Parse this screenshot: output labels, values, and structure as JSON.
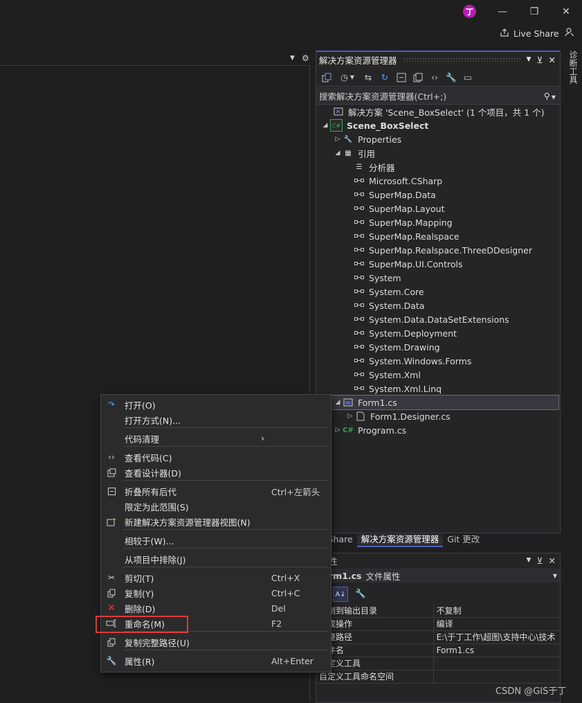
{
  "titlebar": {
    "avatar": "丁",
    "live_share": "Live Share"
  },
  "side_tab": "诊断工具",
  "solution_explorer": {
    "title": "解决方案资源管理器",
    "search_placeholder": "搜索解决方案资源管理器(Ctrl+;)",
    "tree": [
      {
        "label": "解决方案 'Scene_BoxSelect' (1 个项目，共 1 个)",
        "icon": "solution-icon"
      },
      {
        "label": "Scene_BoxSelect",
        "icon": "csharp-project-icon"
      },
      {
        "label": "Properties",
        "icon": "wrench-icon"
      },
      {
        "label": "引用",
        "icon": "references-icon"
      },
      {
        "label": "分析器",
        "icon": "analyzer-icon"
      },
      {
        "label": "Microsoft.CSharp",
        "icon": "reference-icon"
      },
      {
        "label": "SuperMap.Data",
        "icon": "reference-icon"
      },
      {
        "label": "SuperMap.Layout",
        "icon": "reference-icon"
      },
      {
        "label": "SuperMap.Mapping",
        "icon": "reference-icon"
      },
      {
        "label": "SuperMap.Realspace",
        "icon": "reference-icon"
      },
      {
        "label": "SuperMap.Realspace.ThreeDDesigner",
        "icon": "reference-icon"
      },
      {
        "label": "SuperMap.UI.Controls",
        "icon": "reference-icon"
      },
      {
        "label": "System",
        "icon": "reference-icon"
      },
      {
        "label": "System.Core",
        "icon": "reference-icon"
      },
      {
        "label": "System.Data",
        "icon": "reference-icon"
      },
      {
        "label": "System.Data.DataSetExtensions",
        "icon": "reference-icon"
      },
      {
        "label": "System.Deployment",
        "icon": "reference-icon"
      },
      {
        "label": "System.Drawing",
        "icon": "reference-icon"
      },
      {
        "label": "System.Windows.Forms",
        "icon": "reference-icon"
      },
      {
        "label": "System.Xml",
        "icon": "reference-icon"
      },
      {
        "label": "System.Xml.Linq",
        "icon": "reference-icon"
      },
      {
        "label": "Form1.cs",
        "icon": "form-icon"
      },
      {
        "label": "Form1.Designer.cs",
        "icon": "file-icon"
      },
      {
        "label": "Program.cs",
        "icon": "csharp-file-icon"
      }
    ]
  },
  "tabs": [
    "e Share",
    "解决方案资源管理器",
    "Git 更改"
  ],
  "properties": {
    "title": "性",
    "object": "rm1.cs",
    "object_type": "文件属性",
    "rows": [
      {
        "name": "复制到输出目录",
        "value": "不复制"
      },
      {
        "name": "生成操作",
        "value": "编译"
      },
      {
        "name": "完整路径",
        "value": "E:\\于丁工作\\超图\\支持中心\\技术"
      },
      {
        "name": "文件名",
        "value": "Form1.cs"
      },
      {
        "name": "自定义工具",
        "value": ""
      },
      {
        "name": "自定义工具命名空间",
        "value": ""
      }
    ]
  },
  "context_menu": {
    "items": [
      {
        "label": "打开(O)",
        "key": "",
        "icon": "open-icon"
      },
      {
        "label": "打开方式(N)...",
        "key": "",
        "icon": ""
      },
      {
        "label": "代码清理",
        "key": "",
        "icon": "",
        "submenu": "›"
      },
      {
        "label": "查看代码(C)",
        "key": "",
        "icon": "code-icon"
      },
      {
        "label": "查看设计器(D)",
        "key": "",
        "icon": "designer-icon"
      },
      {
        "label": "折叠所有后代",
        "key": "Ctrl+左箭头",
        "icon": "collapse-icon"
      },
      {
        "label": "限定为此范围(S)",
        "key": "",
        "icon": ""
      },
      {
        "label": "新建解决方案资源管理器视图(N)",
        "key": "",
        "icon": "new-view-icon"
      },
      {
        "label": "相较于(W)...",
        "key": "",
        "icon": ""
      },
      {
        "label": "从项目中排除(J)",
        "key": "",
        "icon": ""
      },
      {
        "label": "剪切(T)",
        "key": "Ctrl+X",
        "icon": "cut-icon"
      },
      {
        "label": "复制(Y)",
        "key": "Ctrl+C",
        "icon": "copy-icon"
      },
      {
        "label": "删除(D)",
        "key": "Del",
        "icon": "delete-icon"
      },
      {
        "label": "重命名(M)",
        "key": "F2",
        "icon": "rename-icon"
      },
      {
        "label": "复制完整路径(U)",
        "key": "",
        "icon": "copy-path-icon"
      },
      {
        "label": "属性(R)",
        "key": "Alt+Enter",
        "icon": "wrench-icon"
      }
    ]
  },
  "watermark": "CSDN @GIS于丁",
  "colors": {
    "accent": "#4a5fb6",
    "highlight": "#e0393b",
    "avatar": "#b41fb0"
  }
}
